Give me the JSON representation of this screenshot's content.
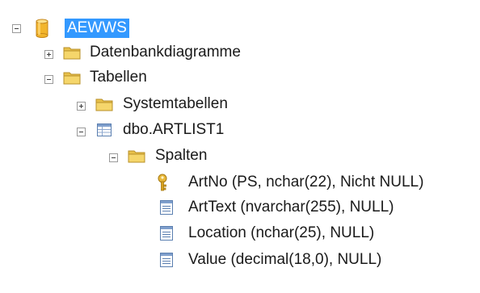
{
  "tree": {
    "database": {
      "label": "AEWWS",
      "icon": "database-cylinder-icon",
      "expanded": true,
      "selected": true
    },
    "nodes": {
      "datenbankdiagramme": {
        "label": "Datenbankdiagramme",
        "icon": "folder-icon",
        "expanded": false
      },
      "tabellen": {
        "label": "Tabellen",
        "icon": "folder-icon",
        "expanded": true
      },
      "systemtabellen": {
        "label": "Systemtabellen",
        "icon": "folder-icon",
        "expanded": false
      },
      "table_artlist1": {
        "label": "dbo.ARTLIST1",
        "icon": "table-icon",
        "expanded": true
      },
      "spalten": {
        "label": "Spalten",
        "icon": "folder-icon",
        "expanded": true
      }
    },
    "columns": [
      {
        "label": "ArtNo (PS, nchar(22), Nicht NULL)",
        "icon": "primary-key-icon"
      },
      {
        "label": "ArtText (nvarchar(255), NULL)",
        "icon": "column-icon"
      },
      {
        "label": "Location (nchar(25), NULL)",
        "icon": "column-icon"
      },
      {
        "label": "Value (decimal(18,0), NULL)",
        "icon": "column-icon"
      }
    ],
    "colors": {
      "selection": "#3399ff",
      "folder": "#e8c14a",
      "database": "#f2b52c",
      "key": "#d8a21f",
      "column_icon": "#5b7fb0"
    }
  }
}
